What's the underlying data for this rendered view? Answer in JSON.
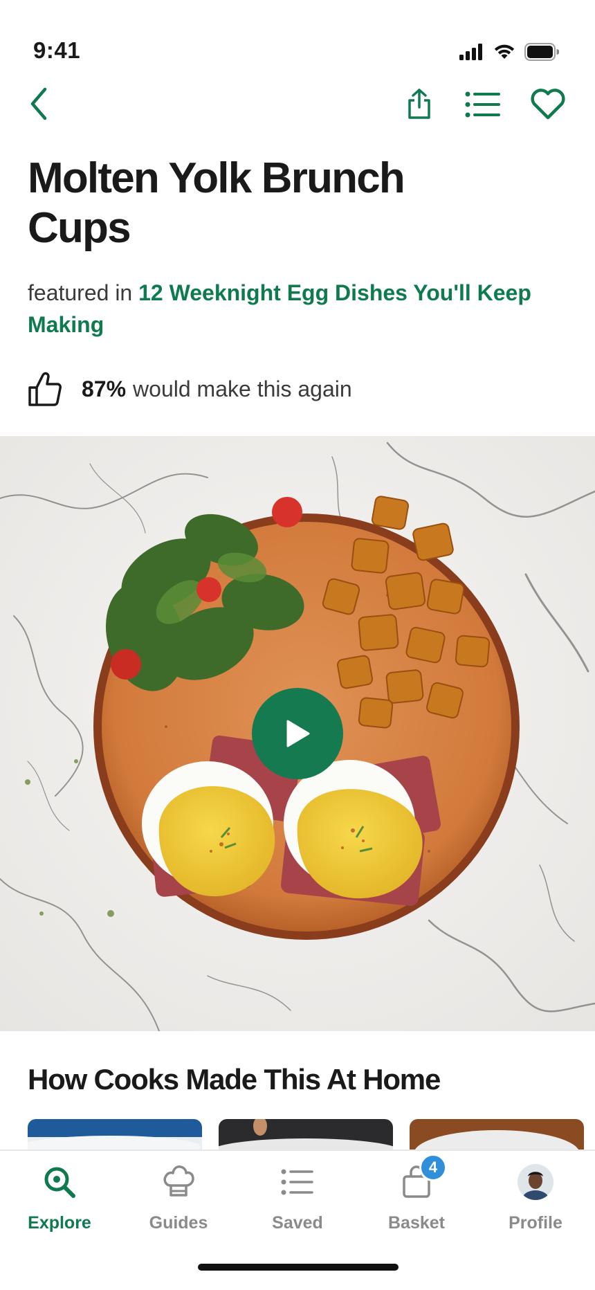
{
  "status_bar": {
    "time": "9:41"
  },
  "nav": {
    "back_icon": "chevron-left-icon",
    "share_icon": "share-icon",
    "list_icon": "list-icon",
    "save_icon": "heart-icon"
  },
  "recipe": {
    "title": "Molten Yolk Brunch Cups",
    "featured_prefix": "featured in",
    "featured_link": "12 Weeknight Egg Dishes You'll Keep Making",
    "rating_percent": "87%",
    "rating_text": "would make this again"
  },
  "hero": {
    "play_icon": "play-icon"
  },
  "cooks_section": {
    "title": "How Cooks Made This At Home"
  },
  "tab_bar": {
    "tabs": [
      {
        "label": "Explore",
        "icon": "explore-search-icon",
        "active": true
      },
      {
        "label": "Guides",
        "icon": "chef-hat-icon",
        "active": false
      },
      {
        "label": "Saved",
        "icon": "list-icon",
        "active": false
      },
      {
        "label": "Basket",
        "icon": "basket-icon",
        "active": false,
        "badge": "4"
      },
      {
        "label": "Profile",
        "icon": "avatar",
        "active": false
      }
    ]
  },
  "colors": {
    "accent": "#0f7a4e",
    "badge": "#2f8fd8",
    "text": "#1a1a1a"
  }
}
